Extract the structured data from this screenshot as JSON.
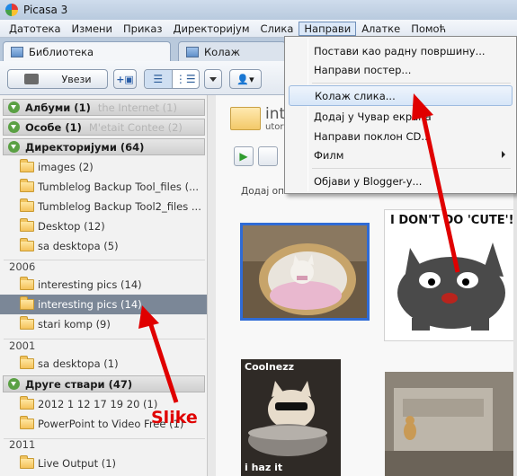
{
  "window": {
    "title": "Picasa 3"
  },
  "menubar": {
    "items": [
      "Датотека",
      "Измени",
      "Приказ",
      "Директоријум",
      "Слика",
      "Направи",
      "Алатке",
      "Помоћ"
    ]
  },
  "tabs": [
    {
      "label": "Библиотека"
    },
    {
      "label": "Колаж"
    }
  ],
  "toolbar": {
    "import_label": "Увези"
  },
  "sidebar": {
    "sections": [
      {
        "label": "Албуми (1)",
        "ghost": "the Internet (1)"
      },
      {
        "label": "Особе (1)",
        "ghost": "M'etait Contee (2)"
      },
      {
        "label": "Директоријуми (64)",
        "ghost": ""
      },
      {
        "label": "Друге ствари (47)",
        "ghost": ""
      }
    ],
    "folders_a": [
      "images (2)",
      "Tumblelog Backup Tool_files (...",
      "Tumblelog Backup Tool2_files ...",
      "Desktop (12)",
      "sa desktopa (5)"
    ],
    "year_2006": "2006",
    "folders_2006": [
      "interesting pics (14)",
      "interesting pics (14)",
      "stari komp (9)"
    ],
    "year_2001": "2001",
    "folders_2001": [
      "sa desktopa (1)"
    ],
    "folders_other": [
      "2012 1 12 17 19 20 (1)",
      "PowerPoint to Video Free (1)"
    ],
    "year_2011": "2011",
    "folders_2011": [
      "Live Output (1)"
    ]
  },
  "main": {
    "album_title": "intere",
    "album_sub": "utorak",
    "add_description": "Додај оп",
    "photo_caption_cute": "I DON'T DO 'CUTE'!",
    "photo_caption_cool": "Coolnezz",
    "photo_caption_haz": "i haz it"
  },
  "dropdown": {
    "items": [
      {
        "label": "Постави као радну површину..."
      },
      {
        "label": "Направи постер..."
      },
      {
        "label": "Колаж слика..."
      },
      {
        "label": "Додај у Чувар екрана"
      },
      {
        "label": "Направи поклон CD..."
      },
      {
        "label": "Филм"
      },
      {
        "label": "Објави у Blogger-у..."
      }
    ]
  },
  "annotation": {
    "label": "Slike"
  },
  "colors": {
    "annotation": "#e00000",
    "selection": "#7b8797",
    "menu_highlight": "#d7e6f8"
  }
}
